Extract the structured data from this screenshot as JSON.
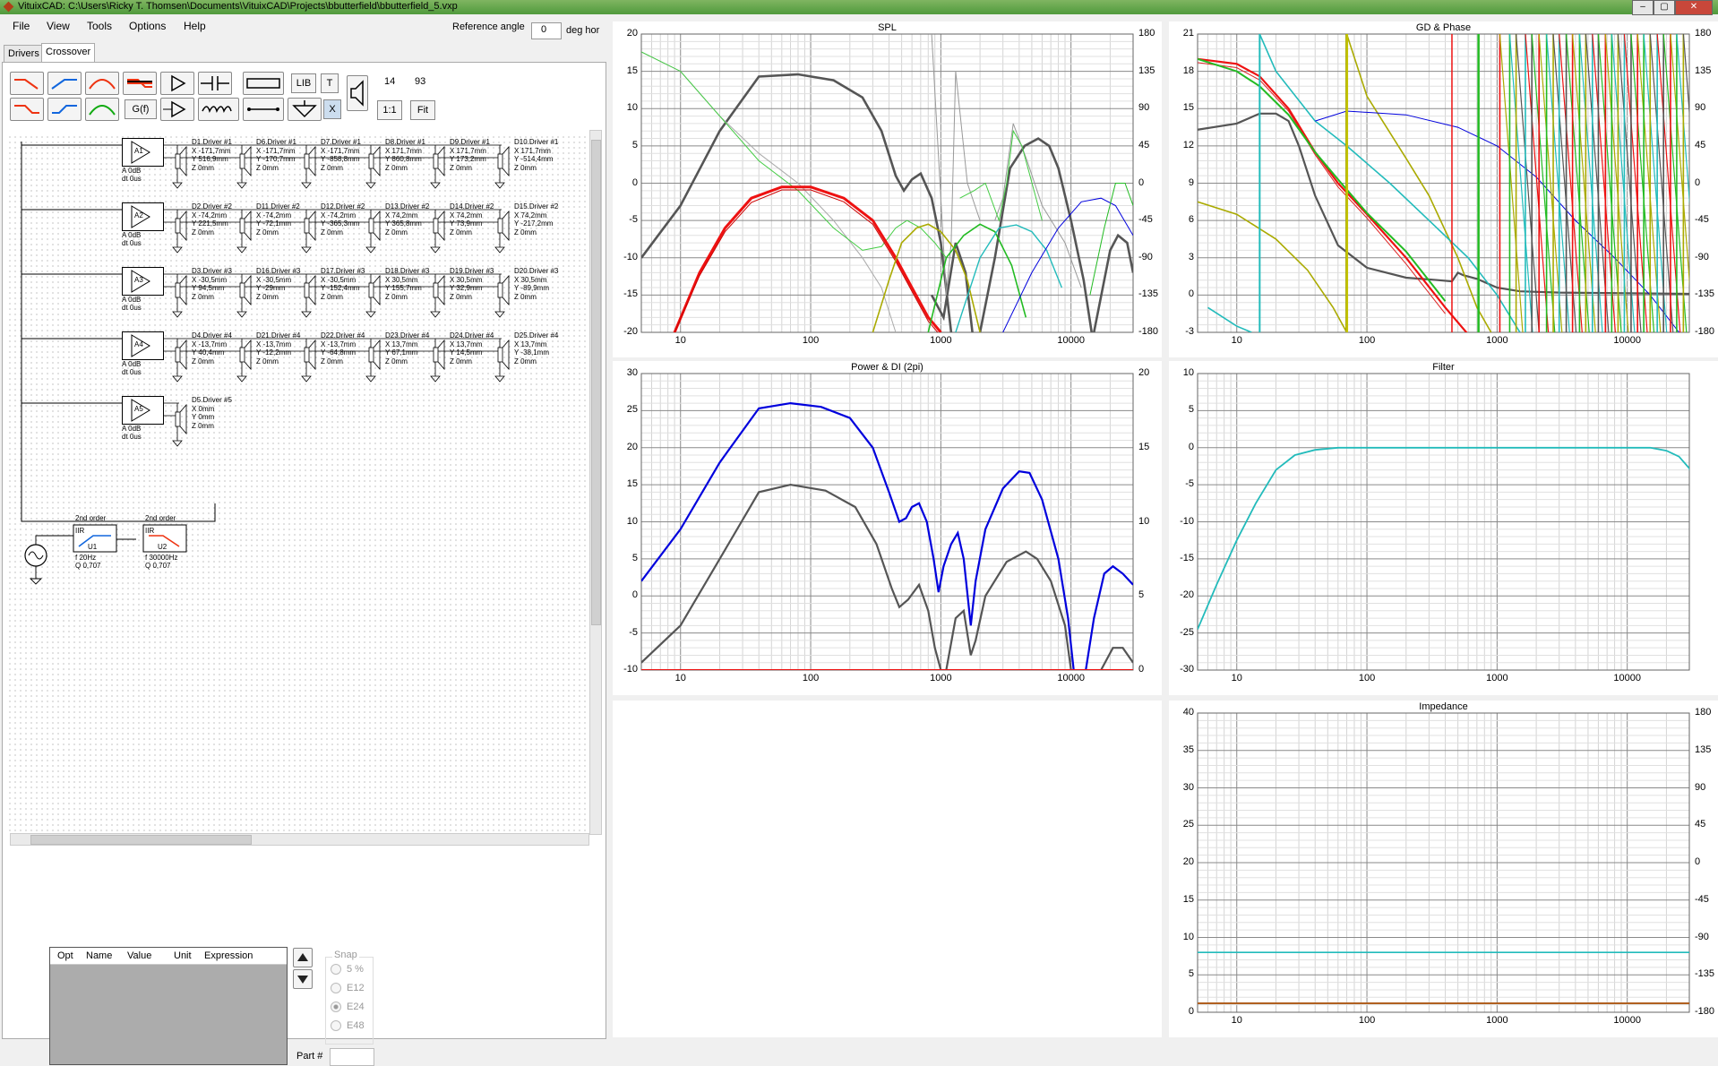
{
  "window": {
    "title": "VituixCAD: C:\\Users\\Ricky T. Thomsen\\Documents\\VituixCAD\\Projects\\bbutterfield\\bbutterfield_5.vxp"
  },
  "menu": [
    "File",
    "View",
    "Tools",
    "Options",
    "Help"
  ],
  "reference": {
    "label": "Reference angle",
    "value": "0",
    "unit": "deg hor"
  },
  "tabs": [
    "Drivers",
    "Crossover"
  ],
  "toolbar": {
    "lib": "LIB",
    "t": "T",
    "x": "X",
    "gf": "G(f)",
    "one_to_one": "1:1",
    "fit": "Fit",
    "count_a": "14",
    "count_b": "93"
  },
  "schematic": {
    "amps": [
      {
        "id": "A1",
        "gain": "A 0dB",
        "delay": "dt 0us"
      },
      {
        "id": "A2",
        "gain": "A 0dB",
        "delay": "dt 0us"
      },
      {
        "id": "A3",
        "gain": "A 0dB",
        "delay": "dt 0us"
      },
      {
        "id": "A4",
        "gain": "A 0dB",
        "delay": "dt 0us"
      },
      {
        "id": "A5",
        "gain": "A 0dB",
        "delay": "dt 0us"
      }
    ],
    "driver_rows": [
      [
        {
          "name": "D1.Driver #1",
          "x": "X -171,7mm",
          "y": "Y 516,9mm",
          "z": "Z 0mm"
        },
        {
          "name": "D6.Driver #1",
          "x": "X -171,7mm",
          "y": "Y -170,7mm",
          "z": "Z 0mm"
        },
        {
          "name": "D7.Driver #1",
          "x": "X -171,7mm",
          "y": "Y -858,8mm",
          "z": "Z 0mm"
        },
        {
          "name": "D8.Driver #1",
          "x": "X 171,7mm",
          "y": "Y 860,8mm",
          "z": "Z 0mm"
        },
        {
          "name": "D9.Driver #1",
          "x": "X 171,7mm",
          "y": "Y 173,2mm",
          "z": "Z 0mm"
        },
        {
          "name": "D10.Driver #1",
          "x": "X 171,7mm",
          "y": "Y -514,4mm",
          "z": "Z 0mm"
        }
      ],
      [
        {
          "name": "D2.Driver #2",
          "x": "X -74,2mm",
          "y": "Y 221,5mm",
          "z": "Z 0mm"
        },
        {
          "name": "D11.Driver #2",
          "x": "X -74,2mm",
          "y": "Y -72,1mm",
          "z": "Z 0mm"
        },
        {
          "name": "D12.Driver #2",
          "x": "X -74,2mm",
          "y": "Y -365,3mm",
          "z": "Z 0mm"
        },
        {
          "name": "D13.Driver #2",
          "x": "X 74,2mm",
          "y": "Y 365,8mm",
          "z": "Z 0mm"
        },
        {
          "name": "D14.Driver #2",
          "x": "X 74,2mm",
          "y": "Y 73,9mm",
          "z": "Z 0mm"
        },
        {
          "name": "D15.Driver #2",
          "x": "X 74,2mm",
          "y": "Y -217,2mm",
          "z": "Z 0mm"
        }
      ],
      [
        {
          "name": "D3.Driver #3",
          "x": "X -30,5mm",
          "y": "Y 94,5mm",
          "z": "Z 0mm"
        },
        {
          "name": "D16.Driver #3",
          "x": "X -30,5mm",
          "y": "Y -29mm",
          "z": "Z 0mm"
        },
        {
          "name": "D17.Driver #3",
          "x": "X -30,5mm",
          "y": "Y -152,4mm",
          "z": "Z 0mm"
        },
        {
          "name": "D18.Driver #3",
          "x": "X 30,5mm",
          "y": "Y 155,7mm",
          "z": "Z 0mm"
        },
        {
          "name": "D19.Driver #3",
          "x": "X 30,5mm",
          "y": "Y 32,9mm",
          "z": "Z 0mm"
        },
        {
          "name": "D20.Driver #3",
          "x": "X 30,5mm",
          "y": "Y -89,9mm",
          "z": "Z 0mm"
        }
      ],
      [
        {
          "name": "D4.Driver #4",
          "x": "X -13,7mm",
          "y": "Y 40,4mm",
          "z": "Z 0mm"
        },
        {
          "name": "D21.Driver #4",
          "x": "X -13,7mm",
          "y": "Y -12,2mm",
          "z": "Z 0mm"
        },
        {
          "name": "D22.Driver #4",
          "x": "X -13,7mm",
          "y": "Y -64,8mm",
          "z": "Z 0mm"
        },
        {
          "name": "D23.Driver #4",
          "x": "X 13,7mm",
          "y": "Y 67,1mm",
          "z": "Z 0mm"
        },
        {
          "name": "D24.Driver #4",
          "x": "X 13,7mm",
          "y": "Y 14,5mm",
          "z": "Z 0mm"
        },
        {
          "name": "D25.Driver #4",
          "x": "X 13,7mm",
          "y": "Y -38,1mm",
          "z": "Z 0mm"
        }
      ],
      [
        {
          "name": "D5.Driver #5",
          "x": "X 0mm",
          "y": "Y 0mm",
          "z": "Z 0mm"
        }
      ]
    ],
    "filters": [
      {
        "title": "2nd order",
        "type": "IIR",
        "id": "U1",
        "f": "f  20Hz",
        "q": "Q 0,707"
      },
      {
        "title": "2nd order",
        "type": "IIR",
        "id": "U2",
        "f": "f  30000Hz",
        "q": "Q 0,707"
      }
    ]
  },
  "param_table": {
    "columns": [
      "Opt",
      "Name",
      "Value",
      "Unit",
      "Expression"
    ]
  },
  "snap": {
    "title": "Snap",
    "options": [
      "5 %",
      "E12",
      "E24",
      "E48"
    ],
    "selected": "E24"
  },
  "part_label": "Part #",
  "charts": [
    {
      "id": "spl",
      "title": "SPL",
      "y_left": [
        "20",
        "15",
        "10",
        "5",
        "0",
        "-5",
        "-10",
        "-15",
        "-20"
      ],
      "y_right": [
        "180",
        "135",
        "90",
        "45",
        "0",
        "-45",
        "-90",
        "-135",
        "-180"
      ],
      "x_ticks": [
        "10",
        "100",
        "1000",
        "10000"
      ]
    },
    {
      "id": "gd",
      "title": "GD & Phase",
      "y_left": [
        "21",
        "18",
        "15",
        "12",
        "9",
        "6",
        "3",
        "0",
        "-3"
      ],
      "y_right": [
        "180",
        "135",
        "90",
        "45",
        "0",
        "-45",
        "-90",
        "-135",
        "-180"
      ],
      "x_ticks": [
        "10",
        "100",
        "1000",
        "10000"
      ]
    },
    {
      "id": "power",
      "title": "Power & DI (2pi)",
      "y_left": [
        "30",
        "25",
        "20",
        "15",
        "10",
        "5",
        "0",
        "-5",
        "-10"
      ],
      "y_right": [
        "20",
        "15",
        "10",
        "5",
        "0"
      ],
      "x_ticks": [
        "10",
        "100",
        "1000",
        "10000"
      ]
    },
    {
      "id": "filter",
      "title": "Filter",
      "y_left": [
        "10",
        "5",
        "0",
        "-5",
        "-10",
        "-15",
        "-20",
        "-25",
        "-30"
      ],
      "y_right": [],
      "x_ticks": [
        "10",
        "100",
        "1000",
        "10000"
      ]
    },
    {
      "id": "imp",
      "title": "Impedance",
      "y_left": [
        "40",
        "35",
        "30",
        "25",
        "20",
        "15",
        "10",
        "5",
        "0"
      ],
      "y_right": [
        "180",
        "135",
        "90",
        "45",
        "0",
        "-45",
        "-90",
        "-135",
        "-180"
      ],
      "x_ticks": [
        "10",
        "100",
        "1000",
        "10000"
      ]
    }
  ],
  "colors": {
    "titlebar": "#5ca546",
    "plot_blue": "#0000dd",
    "plot_gray": "#555555",
    "plot_red": "#ee1111",
    "plot_cyan": "#22bbbb",
    "plot_green": "#22bb22",
    "plot_olive": "#aaaa00"
  }
}
